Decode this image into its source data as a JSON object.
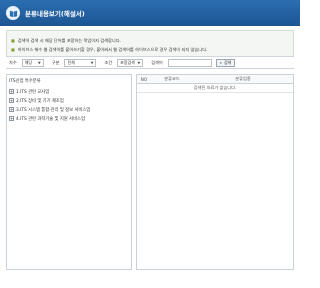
{
  "window": {
    "title": "분류내용보기(해설서)"
  },
  "info": {
    "lines": [
      "검색어 검색 시 해당 단어를 포함하는 목업이지 검색합니다.",
      "하이브스 해수 웹 검색어를 붙어쓰기할 경우, 붙어써서 웹 검색어를 하이브스으로 경우 검색이 되지 않습니다.",
      "분류코드 검색 시 일치하는 코드만 검색합니다."
    ]
  },
  "search": {
    "level_label": "차수",
    "level_value": "해당",
    "category_label": "구분",
    "category_value": "전체",
    "condition_label": "조건",
    "condition_value": "포함검색",
    "keyword_label": "검색어",
    "keyword_value": "",
    "search_button": "검색"
  },
  "tree": {
    "root": "ITS산업 특수분류",
    "items": [
      "1.ITS 관련 교사업",
      "2.ITS 장비 및 기기 제조업",
      "3.ITS 시스템 통합·관리 및 정보 서비스업",
      "4.ITS 관련 과학기술 및 지원 서비스업"
    ]
  },
  "results": {
    "columns": [
      "NO",
      "분류코드",
      "분류업종"
    ],
    "empty_message": "검색된 자료가 없습니다."
  },
  "colors": {
    "title_bar": "#1d5592",
    "info_bg": "#f3f6f2",
    "bullet": "#8a9a2e"
  }
}
